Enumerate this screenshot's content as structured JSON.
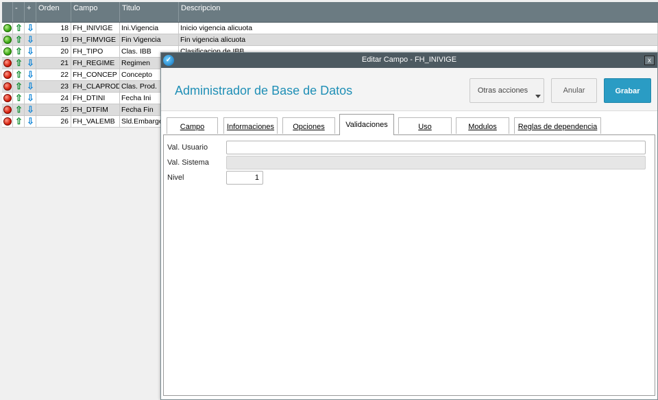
{
  "grid": {
    "columns": [
      "",
      "-",
      "+",
      "Orden",
      "Campo",
      "Titulo",
      "Descripcion"
    ],
    "rows": [
      {
        "status": "green",
        "orden": "18",
        "campo": "FH_INIVIGE",
        "titulo": "Ini.Vigencia",
        "descripcion": "Inicio vigencia alicuota"
      },
      {
        "status": "green",
        "orden": "19",
        "campo": "FH_FIMVIGE",
        "titulo": "Fin Vigencia",
        "descripcion": "Fin vigencia alicuota"
      },
      {
        "status": "green",
        "orden": "20",
        "campo": "FH_TIPO",
        "titulo": "Clas. IBB",
        "descripcion": "Clasificacion de IBB"
      },
      {
        "status": "red",
        "orden": "21",
        "campo": "FH_REGIME",
        "titulo": "Regimen",
        "descripcion": ""
      },
      {
        "status": "red",
        "orden": "22",
        "campo": "FH_CONCEP",
        "titulo": "Concepto",
        "descripcion": ""
      },
      {
        "status": "red",
        "orden": "23",
        "campo": "FH_CLAPROD",
        "titulo": "Clas. Prod.",
        "descripcion": ""
      },
      {
        "status": "red",
        "orden": "24",
        "campo": "FH_DTINI",
        "titulo": "Fecha Ini",
        "descripcion": ""
      },
      {
        "status": "red",
        "orden": "25",
        "campo": "FH_DTFIM",
        "titulo": "Fecha Fin",
        "descripcion": ""
      },
      {
        "status": "red",
        "orden": "26",
        "campo": "FH_VALEMB",
        "titulo": "Sld.Embarge",
        "descripcion": ""
      }
    ],
    "up_arrow": "⇧",
    "down_arrow": "⇩"
  },
  "dialog": {
    "title": "Editar Campo - FH_INIVIGE",
    "close_label": "x",
    "app_title": "Administrador de Base de Datos",
    "buttons": {
      "otras": "Otras acciones",
      "anular": "Anular",
      "grabar": "Grabar"
    },
    "tabs": [
      "Campo",
      "Informaciones",
      "Opciones",
      "Validaciones",
      "Uso",
      "Modulos",
      "Reglas de dependencia"
    ],
    "active_tab": "Validaciones",
    "fields": {
      "val_usuario_label": "Val. Usuario",
      "val_usuario_value": "",
      "val_sistema_label": "Val. Sistema",
      "val_sistema_value": "",
      "nivel_label": "Nivel",
      "nivel_value": "1"
    }
  },
  "colors": {
    "accent": "#2a9cc4",
    "title_text": "#1f8fb6",
    "header_bar": "#6b7b82",
    "titlebar": "#4d5a61"
  }
}
